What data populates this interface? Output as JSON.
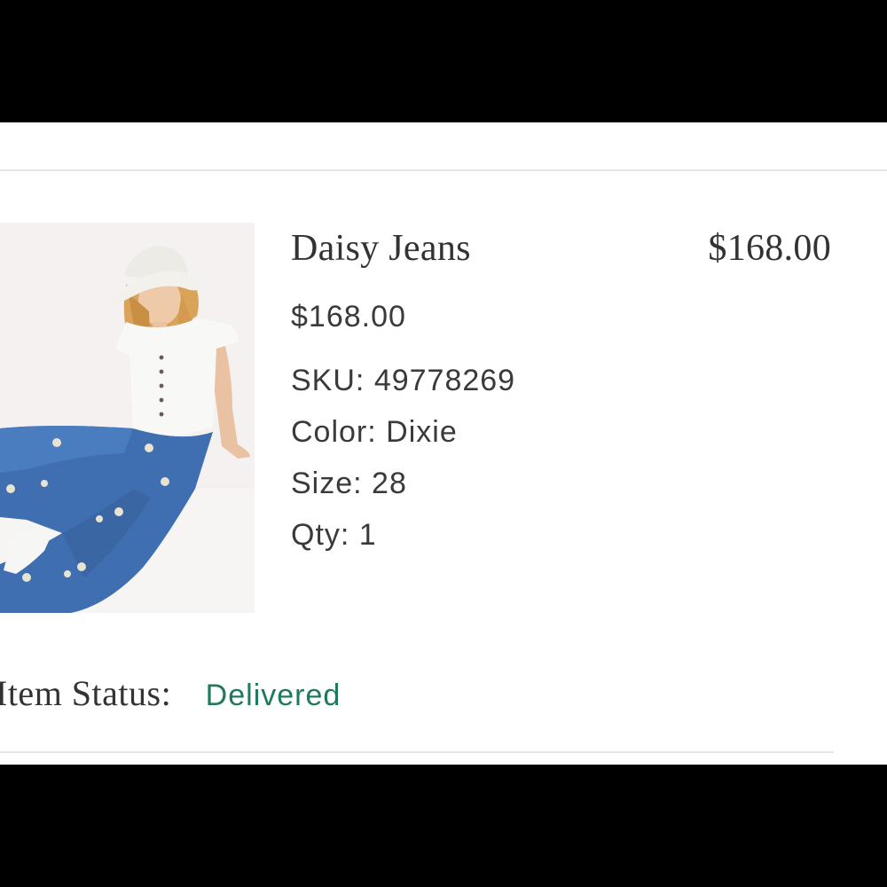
{
  "item": {
    "name": "Daisy Jeans",
    "line_total": "$168.00",
    "unit_price": "$168.00",
    "sku_label": "SKU:",
    "sku_value": "49778269",
    "color_label": "Color:",
    "color_value": "Dixie",
    "size_label": "Size:",
    "size_value": "28",
    "qty_label": "Qty:",
    "qty_value": "1",
    "status_label": "Item Status:",
    "status_value": "Delivered",
    "status_color": "#1f7a5c"
  },
  "colors": {
    "background": "#000000",
    "panel": "#ffffff",
    "text": "#333333",
    "divider": "#e6e6e6",
    "denim": "#3f6fb0"
  }
}
